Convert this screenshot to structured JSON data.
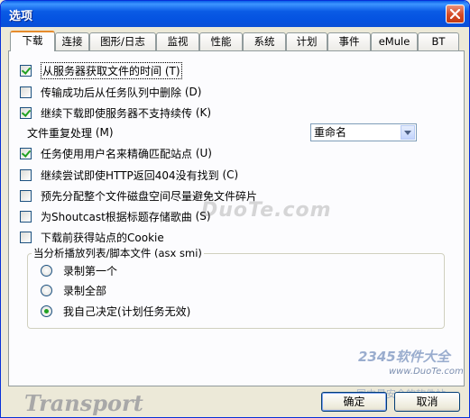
{
  "window": {
    "title": "选项"
  },
  "tabs": [
    {
      "label": "下载",
      "active": true
    },
    {
      "label": "连接"
    },
    {
      "label": "图形/日志"
    },
    {
      "label": "监视"
    },
    {
      "label": "性能"
    },
    {
      "label": "系统"
    },
    {
      "label": "计划"
    },
    {
      "label": "事件"
    },
    {
      "label": "eMule"
    },
    {
      "label": "BT"
    }
  ],
  "options": {
    "get_time_from_server": {
      "label": "从服务器获取文件的时间",
      "hotkey": "(T)",
      "checked": true
    },
    "delete_after_transfer": {
      "label": "传输成功后从任务队列中删除",
      "hotkey": "(D)",
      "checked": false
    },
    "continue_if_no_resume": {
      "label": "继续下载即使服务器不支持续传",
      "hotkey": "(K)",
      "checked": true
    },
    "duplicate_label": "文件重复处理",
    "duplicate_hotkey": "(M)",
    "duplicate_value": "重命名",
    "match_site_user": {
      "label": "任务使用用户名来精确匹配站点",
      "hotkey": "(U)",
      "checked": true
    },
    "retry_on_404": {
      "label": "继续尝试即使HTTP返回404没有找到",
      "hotkey": "(C)",
      "checked": false
    },
    "preallocate": {
      "label": "预先分配整个文件磁盘空间尽量避免文件碎片",
      "hotkey": "",
      "checked": false
    },
    "shoutcast_title": {
      "label": "为Shoutcast根据标题存储歌曲",
      "hotkey": "(S)",
      "checked": false
    },
    "get_cookie": {
      "label": "下载前获得站点的Cookie",
      "hotkey": "",
      "checked": false
    }
  },
  "playlist_group": {
    "legend": "当分析播放列表/脚本文件 (asx smi)",
    "choices": [
      {
        "label": "录制第一个",
        "selected": false
      },
      {
        "label": "录制全部",
        "selected": false
      },
      {
        "label": "我自己决定(计划任务无效)",
        "selected": true
      }
    ]
  },
  "footer": {
    "brand": "Transport",
    "ok_label": "确定",
    "cancel_label": "取消"
  },
  "watermarks": {
    "center": "DuoTe.com",
    "corner_top": "2345软件大全",
    "corner_url": "www.DuoTe.com",
    "corner_bottom": "国内最安全的软件站"
  },
  "colors": {
    "titlebar": "#0a5be5",
    "face": "#ece9d8",
    "panel": "#fcfcfe",
    "check": "#21a121",
    "active_tab_accent": "#e68b2c"
  }
}
